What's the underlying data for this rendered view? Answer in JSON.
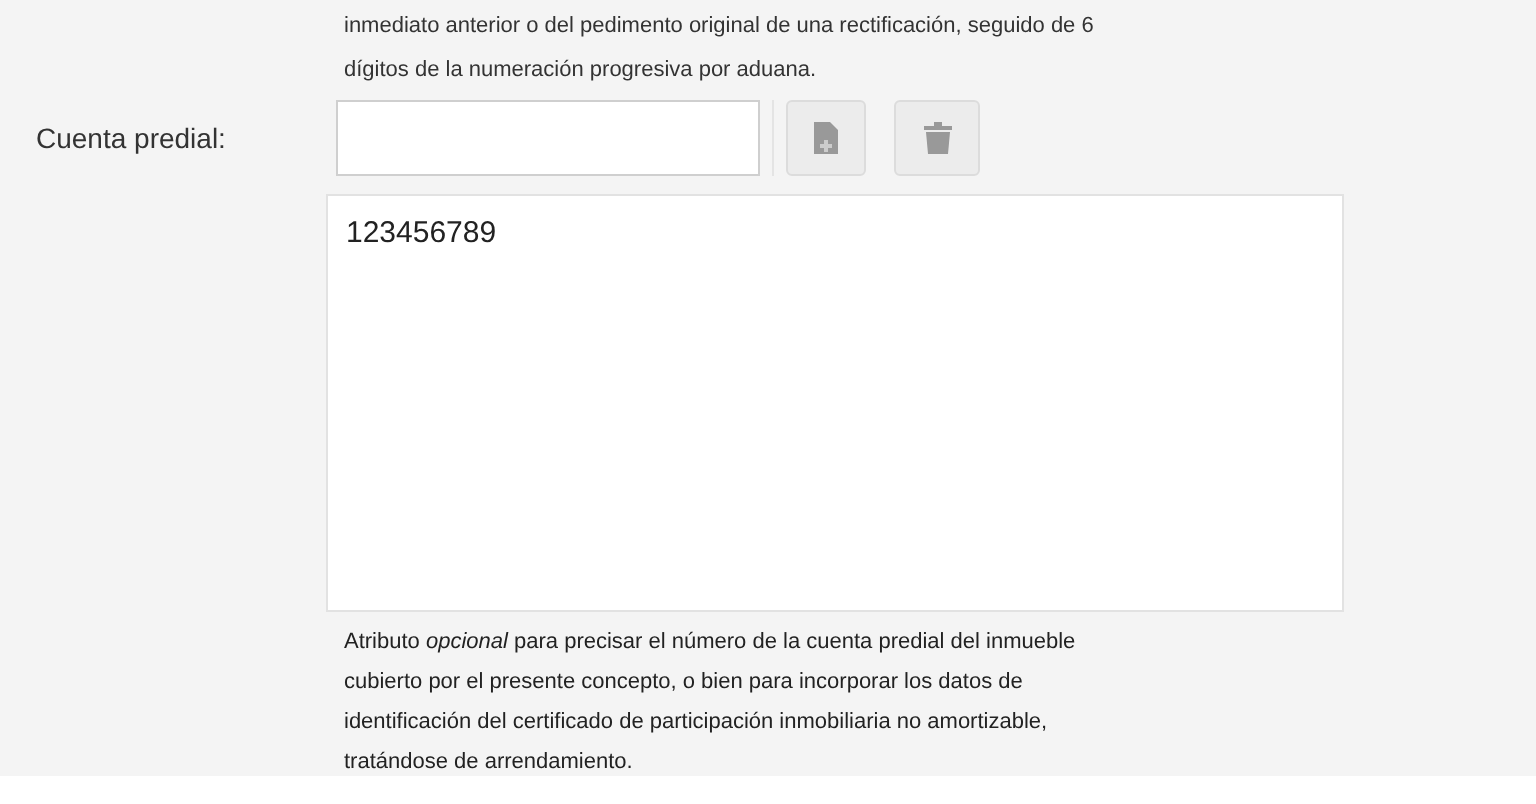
{
  "previous_help": {
    "lines": [
      "inmediato anterior o del pedimento original de una rectificación, seguido de 6",
      "dígitos de la numeración progresiva por aduana."
    ]
  },
  "field": {
    "label": "Cuenta predial:",
    "entries": [
      "123456789"
    ],
    "help_lines": [
      "Atributo *opcional* para precisar el número de la cuenta predial del inmueble",
      "cubierto por el presente concepto, o bien para incorporar los datos de",
      "identificación del certificado de participación inmobiliaria no amortizable,",
      "tratándose de arrendamiento."
    ]
  }
}
